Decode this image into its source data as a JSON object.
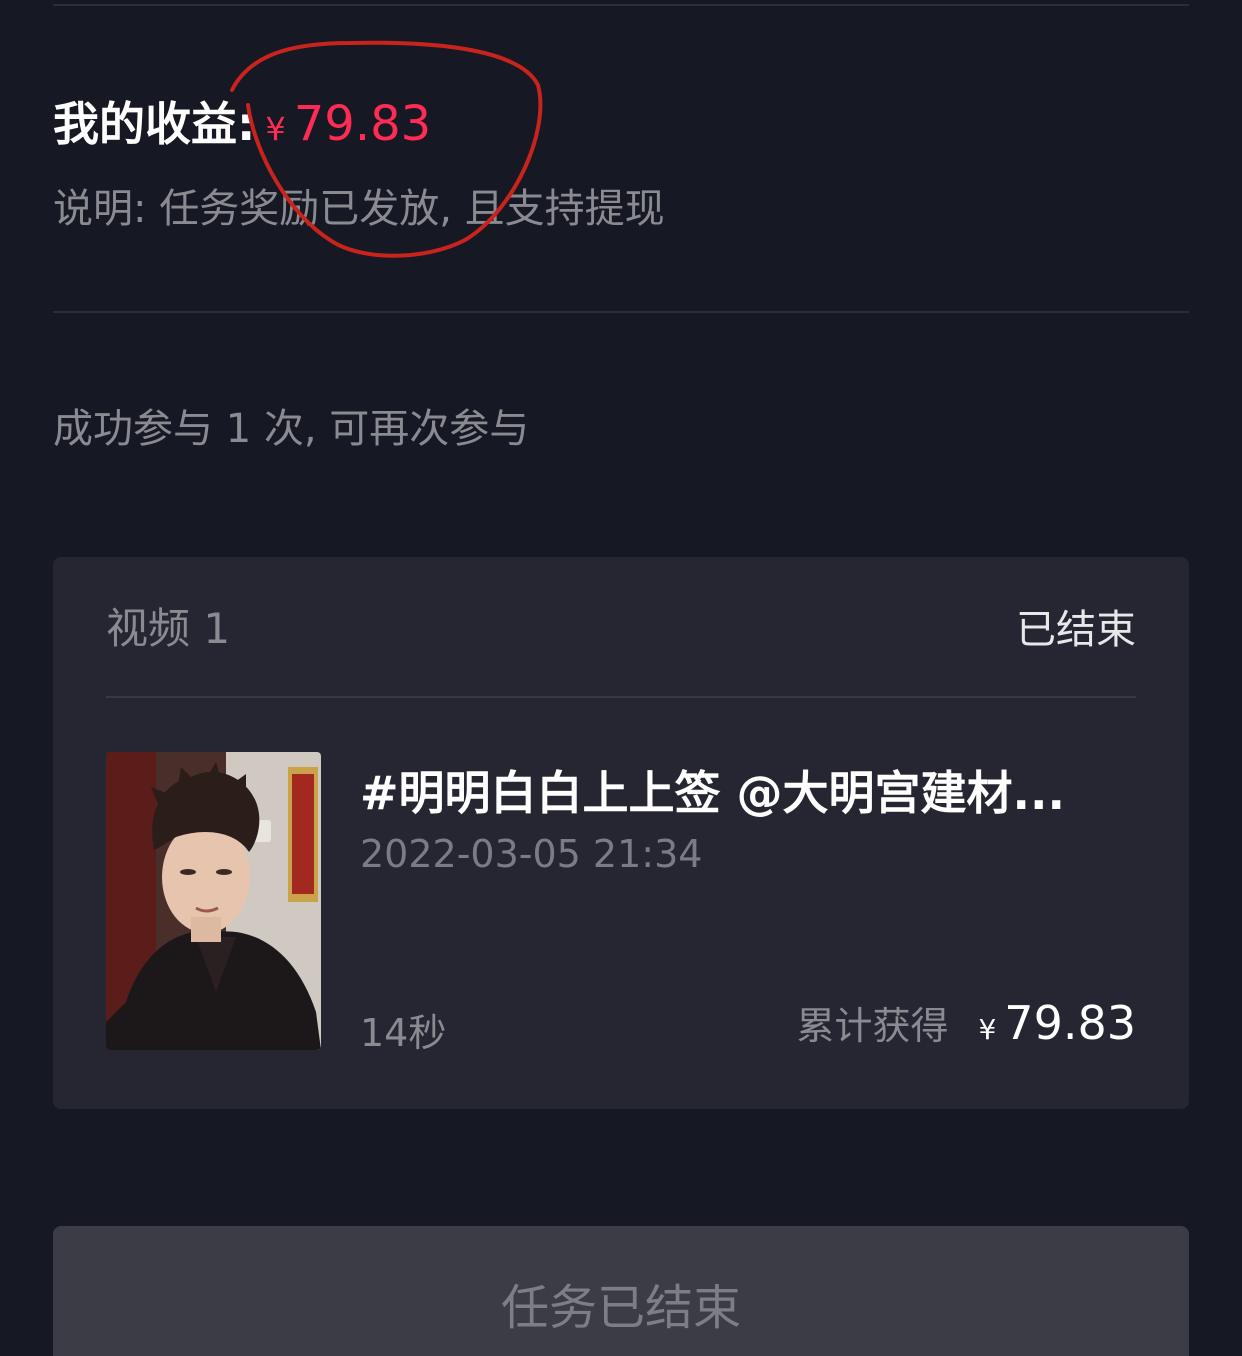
{
  "earnings": {
    "label": "我的收益:",
    "currency": "¥",
    "value": "79.83",
    "note": "说明: 任务奖励已发放, 且支持提现",
    "accent_color": "#fe2c55"
  },
  "participation": {
    "text": "成功参与 1 次, 可再次参与"
  },
  "video_card": {
    "title": "视频 1",
    "status": "已结束",
    "video": {
      "title": "#明明白白上上签 @大明宫建材...",
      "date": "2022-03-05 21:34",
      "duration": "14秒",
      "accum_label": "累计获得",
      "accum_currency": "¥",
      "accum_value": "79.83"
    }
  },
  "bottom_button": {
    "label": "任务已结束"
  },
  "icons": [
    "hand-drawn-highlight-circle"
  ]
}
